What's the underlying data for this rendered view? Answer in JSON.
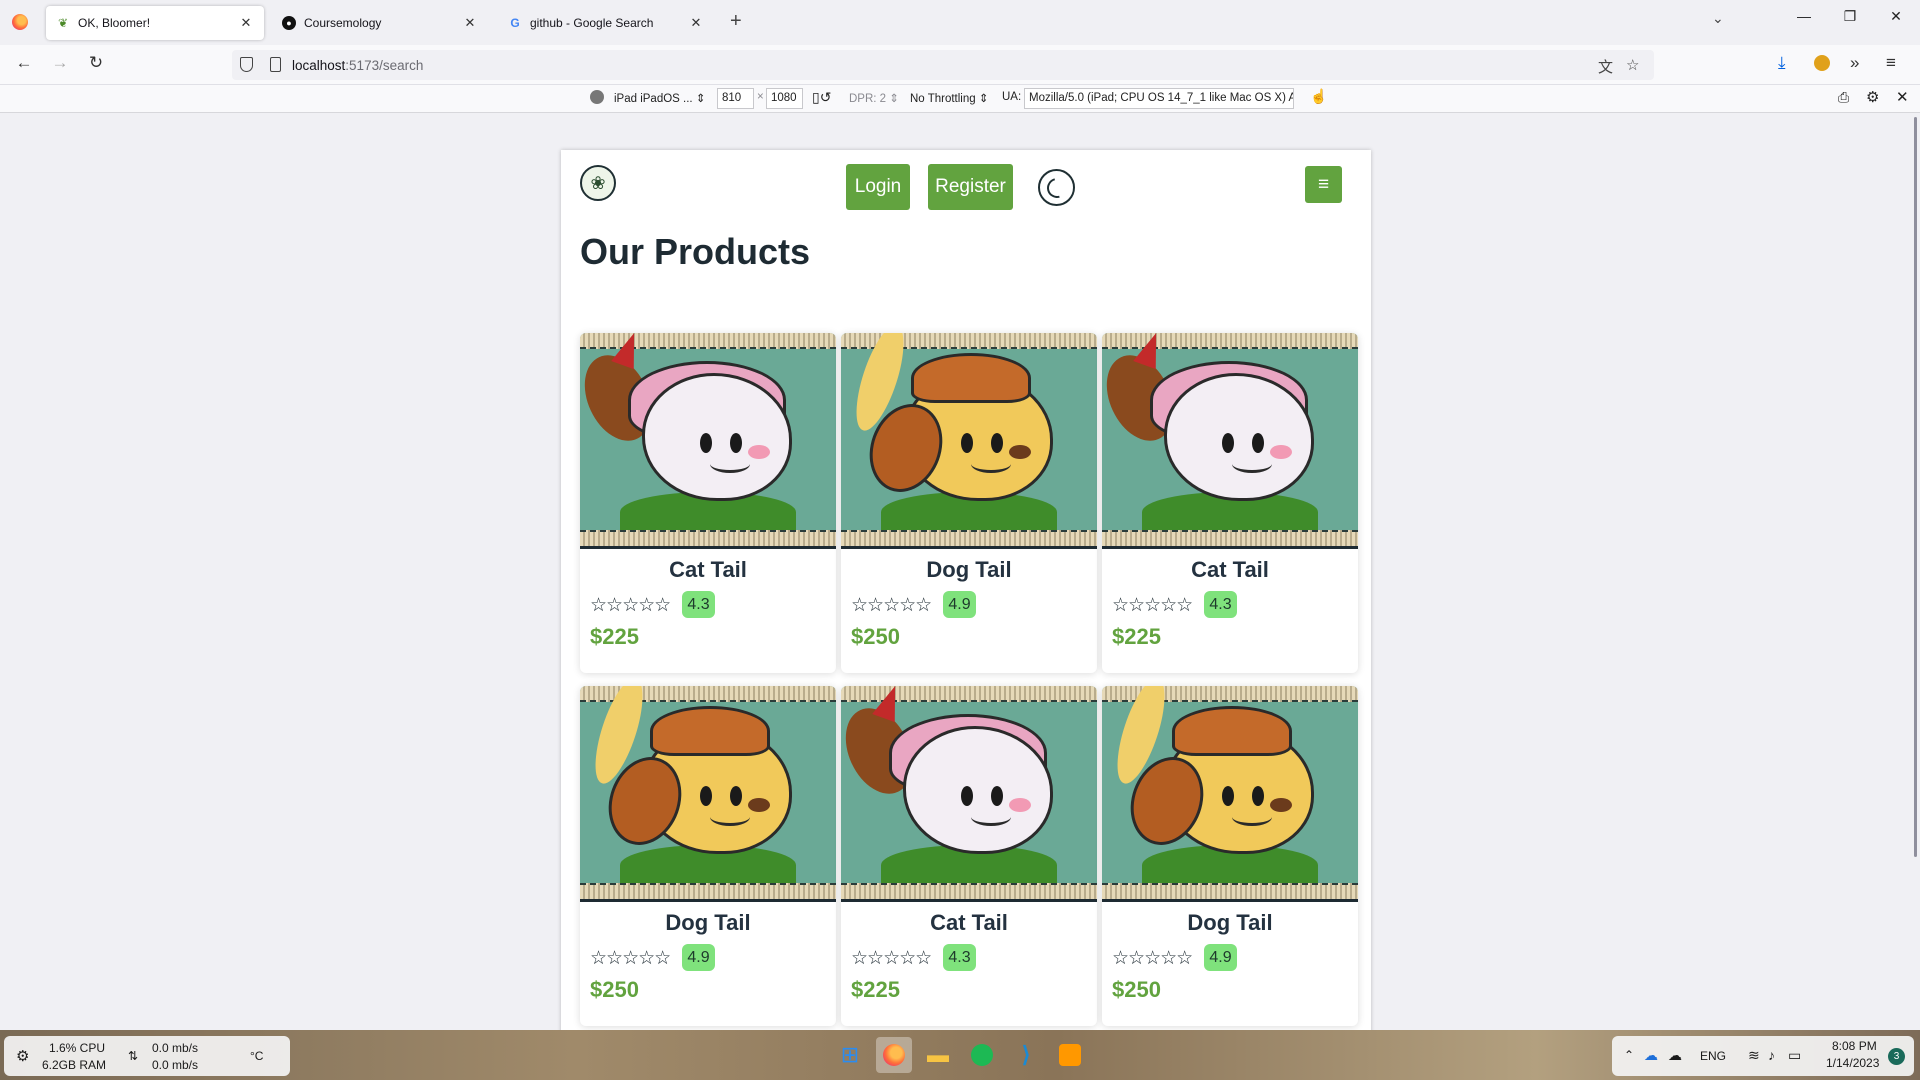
{
  "browser": {
    "tabs": [
      {
        "title": "OK, Bloomer!",
        "active": true,
        "favicon": "leaf-icon"
      },
      {
        "title": "Coursemology",
        "active": false,
        "favicon": "coursemology-icon"
      },
      {
        "title": "github - Google Search",
        "active": false,
        "favicon": "google-g-icon"
      }
    ],
    "url": {
      "host": "localhost",
      "rest": ":5173/search"
    }
  },
  "rdm": {
    "device": "iPad iPadOS ...",
    "width": "810",
    "x": "×",
    "height": "1080",
    "dpr": "DPR: 2",
    "throttling": "No Throttling",
    "ua_label": "UA:",
    "ua_value": "Mozilla/5.0 (iPad; CPU OS 14_7_1 like Mac OS X) Ap"
  },
  "site": {
    "login": "Login",
    "register": "Register",
    "hamburger": "≡",
    "page_title": "Our Products",
    "stars": "☆☆☆☆☆",
    "products": [
      {
        "name": "Cat Tail",
        "rating": "4.3",
        "price": "$225"
      },
      {
        "name": "Dog Tail",
        "rating": "4.9",
        "price": "$250"
      },
      {
        "name": "Cat Tail",
        "rating": "4.3",
        "price": "$225"
      },
      {
        "name": "Dog Tail",
        "rating": "4.9",
        "price": "$250"
      },
      {
        "name": "Cat Tail",
        "rating": "4.3",
        "price": "$225"
      },
      {
        "name": "Dog Tail",
        "rating": "4.9",
        "price": "$250"
      }
    ]
  },
  "taskbar": {
    "cpu": "1.6% CPU",
    "ram": "6.2GB RAM",
    "net_up": "0.0 mb/s",
    "net_down": "0.0 mb/s",
    "temp": "°C",
    "lang": "ENG",
    "time": "8:08 PM",
    "date": "1/14/2023",
    "notifications": "3"
  }
}
